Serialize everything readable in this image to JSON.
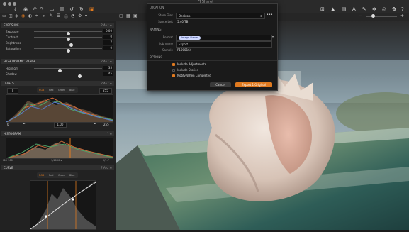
{
  "window": {
    "title": "FI Sharet"
  },
  "dialog": {
    "location": {
      "heading": "LOCATION",
      "store_files_label": "Store Files",
      "store_files_value": "Desktop",
      "space_left_label": "Space Left",
      "space_left_value": "5.40 TB"
    },
    "naming": {
      "heading": "NAMING",
      "format_label": "Format",
      "format_token": "Image Name",
      "job_name_label": "Job name",
      "job_name_value": "Export",
      "sample_label": "Sample",
      "sample_value": "P1000164"
    },
    "options": {
      "heading": "OPTIONS",
      "items": [
        "Include Adjustments",
        "Include Stories",
        "Notify When Completed"
      ]
    },
    "cancel_label": "Cancel",
    "export_label": "Export 1 Original"
  },
  "exposure": {
    "title": "EXPOSURE",
    "rows": [
      {
        "label": "Exposure",
        "value": "0.00"
      },
      {
        "label": "Contrast",
        "value": "0"
      },
      {
        "label": "Brightness",
        "value": "7"
      },
      {
        "label": "Saturation",
        "value": "0"
      }
    ]
  },
  "hdr": {
    "title": "HIGH DYNAMIC RANGE",
    "rows": [
      {
        "label": "Highlight",
        "value": "35"
      },
      {
        "label": "Shadow",
        "value": "45"
      }
    ]
  },
  "levels": {
    "title": "LEVELS",
    "tabs": [
      "RGB",
      "Red",
      "Green",
      "Blue"
    ],
    "left_value": "0",
    "right_value": "255",
    "bottom_left": "0",
    "bottom_mid": "1.00",
    "bottom_right": "255"
  },
  "histogram": {
    "title": "HISTOGRAM",
    "left_text": "ISO 160",
    "mid_text": "1/4000 s",
    "right_text": "f/1.7"
  },
  "curve": {
    "title": "CURVE",
    "tabs": [
      "RGB",
      "Red",
      "Green",
      "Blue"
    ]
  },
  "icons": {
    "top_left": [
      "import-icon",
      "camera-icon",
      "undo-icon",
      "redo-icon",
      "folder-icon",
      "trash-icon",
      "rotate-left-icon",
      "rotate-right-icon",
      "crop-icon"
    ],
    "top_right": [
      "grid-icon",
      "warning-icon",
      "compare-icon",
      "text-icon",
      "brush-icon",
      "gear-icon",
      "export-icon",
      "settings-icon",
      "help-icon"
    ]
  },
  "colors": {
    "accent": "#e07a1f",
    "token": "#cfd8ff"
  }
}
